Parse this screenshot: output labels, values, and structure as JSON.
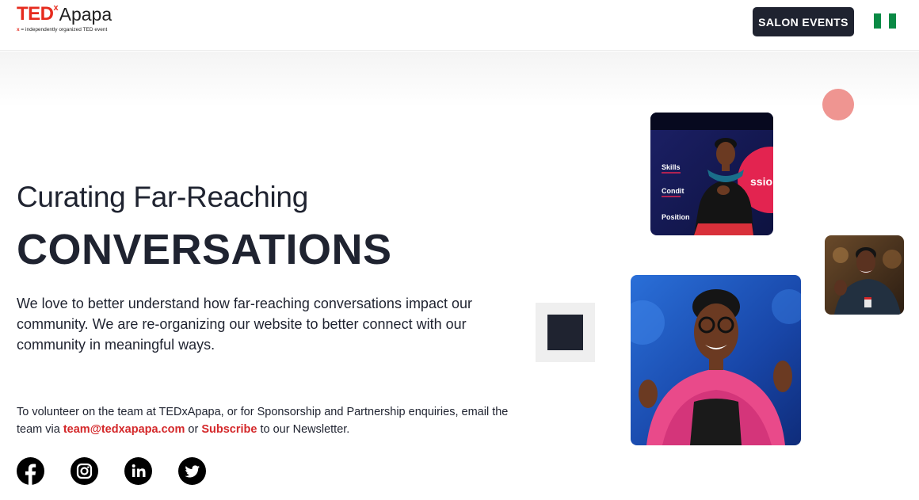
{
  "header": {
    "logo": {
      "brand": "TED",
      "x": "x",
      "name": "Apapa",
      "tag_x": "x",
      "tag_rest": " = independently organized TED event"
    },
    "salon_events_label": "SALON EVENTS",
    "flag_colors": [
      "#0a8a45",
      "#ffffff",
      "#0a8a45"
    ]
  },
  "hero": {
    "subtitle": "Curating Far-Reaching",
    "title": "CONVERSATIONS",
    "description": "We love to better understand how far-reaching conversations impact our community. We are re-organizing our website to better connect with our community in meaningful ways.",
    "volunteer": {
      "text_before": "To volunteer on the team at TEDxApapa, or for Sponsorship and Partnership enquiries, email the team via ",
      "email_link": "team@tedxapapa.com",
      "text_middle": " or ",
      "subscribe_link": "Subscribe",
      "text_after": " to our Newsletter."
    }
  },
  "social": [
    {
      "icon": "facebook-icon"
    },
    {
      "icon": "instagram-icon"
    },
    {
      "icon": "linkedin-icon"
    },
    {
      "icon": "twitter-icon"
    }
  ],
  "photos": {
    "photo1_slide_words": [
      "Skills",
      "Condit",
      "Position",
      "ssio"
    ]
  },
  "colors": {
    "accent": "#e62b1e",
    "link": "#d4282a",
    "dark": "#1f2330",
    "pink_dot": "#ef9591"
  }
}
